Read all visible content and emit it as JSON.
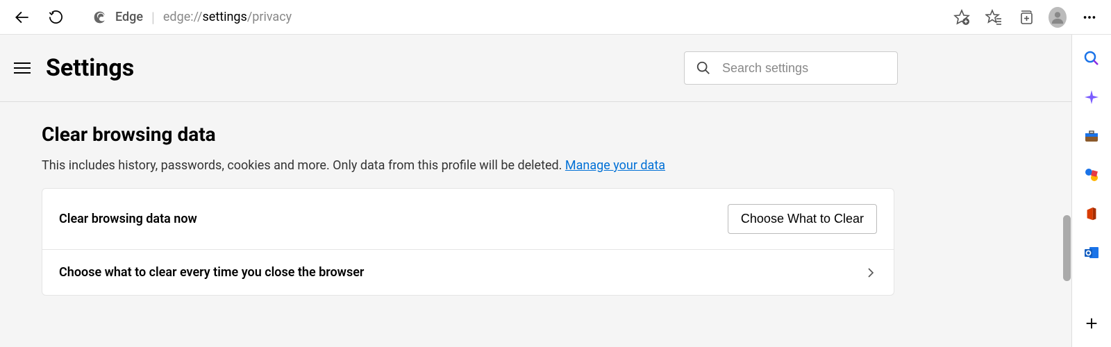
{
  "toolbar": {
    "url_prefix": "edge://",
    "url_bold": "settings",
    "url_suffix": "/privacy",
    "edge_label": "Edge"
  },
  "header": {
    "title": "Settings",
    "search_placeholder": "Search settings"
  },
  "section": {
    "title": "Clear browsing data",
    "description": "This includes history, passwords, cookies and more. Only data from this profile will be deleted. ",
    "manage_link": "Manage your data",
    "row1_label": "Clear browsing data now",
    "row1_button": "Choose What to Clear",
    "row2_label": "Choose what to clear every time you close the browser"
  }
}
